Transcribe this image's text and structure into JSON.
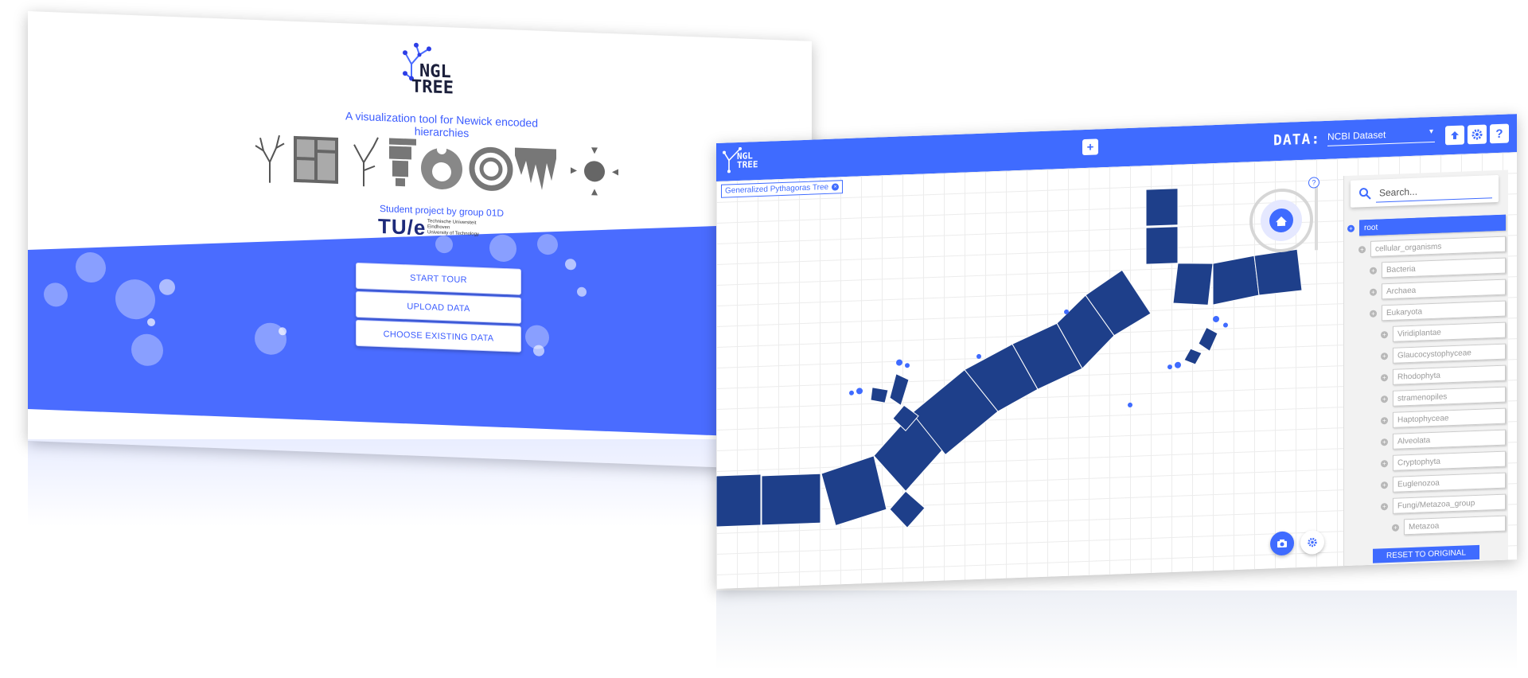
{
  "landing": {
    "logo_line1": "NGL",
    "logo_line2": "TREE",
    "tagline": "A visualization tool for Newick encoded hierarchies",
    "credit": "Student project by group 01D",
    "university_logo": "TU/e",
    "university_line1": "Technische Universiteit",
    "university_line2": "Eindhoven",
    "university_line3": "University of Technology",
    "buttons": {
      "start_tour": "START TOUR",
      "upload": "UPLOAD DATA",
      "choose": "CHOOSE EXISTING DATA"
    },
    "accent_color": "#4a6cff"
  },
  "app": {
    "logo_line1": "NGL",
    "logo_line2": "TREE",
    "add_tab_label": "+",
    "data_label": "DATA:",
    "dataset_selected": "NCBI Dataset",
    "header_icons": [
      "upload-icon",
      "gear-icon",
      "help-icon"
    ],
    "help_label": "?",
    "tab_label": "Generalized Pythagoras Tree",
    "search_placeholder": "Search...",
    "tree": [
      {
        "label": "root",
        "level": 0
      },
      {
        "label": "cellular_organisms",
        "level": 1
      },
      {
        "label": "Bacteria",
        "level": 2
      },
      {
        "label": "Archaea",
        "level": 2
      },
      {
        "label": "Eukaryota",
        "level": 2
      },
      {
        "label": "Viridiplantae",
        "level": 3
      },
      {
        "label": "Glaucocystophyceae",
        "level": 3
      },
      {
        "label": "Rhodophyta",
        "level": 3
      },
      {
        "label": "stramenopiles",
        "level": 3
      },
      {
        "label": "Haptophyceae",
        "level": 3
      },
      {
        "label": "Alveolata",
        "level": 3
      },
      {
        "label": "Cryptophyta",
        "level": 3
      },
      {
        "label": "Euglenozoa",
        "level": 3
      },
      {
        "label": "Fungi/Metazoa_group",
        "level": 3
      },
      {
        "label": "Metazoa",
        "level": 4
      }
    ],
    "reset_label": "RESET TO ORIGINAL",
    "nav_help_label": "?",
    "accent_color": "#3f6bff",
    "tree_color": "#1e3f8a"
  }
}
